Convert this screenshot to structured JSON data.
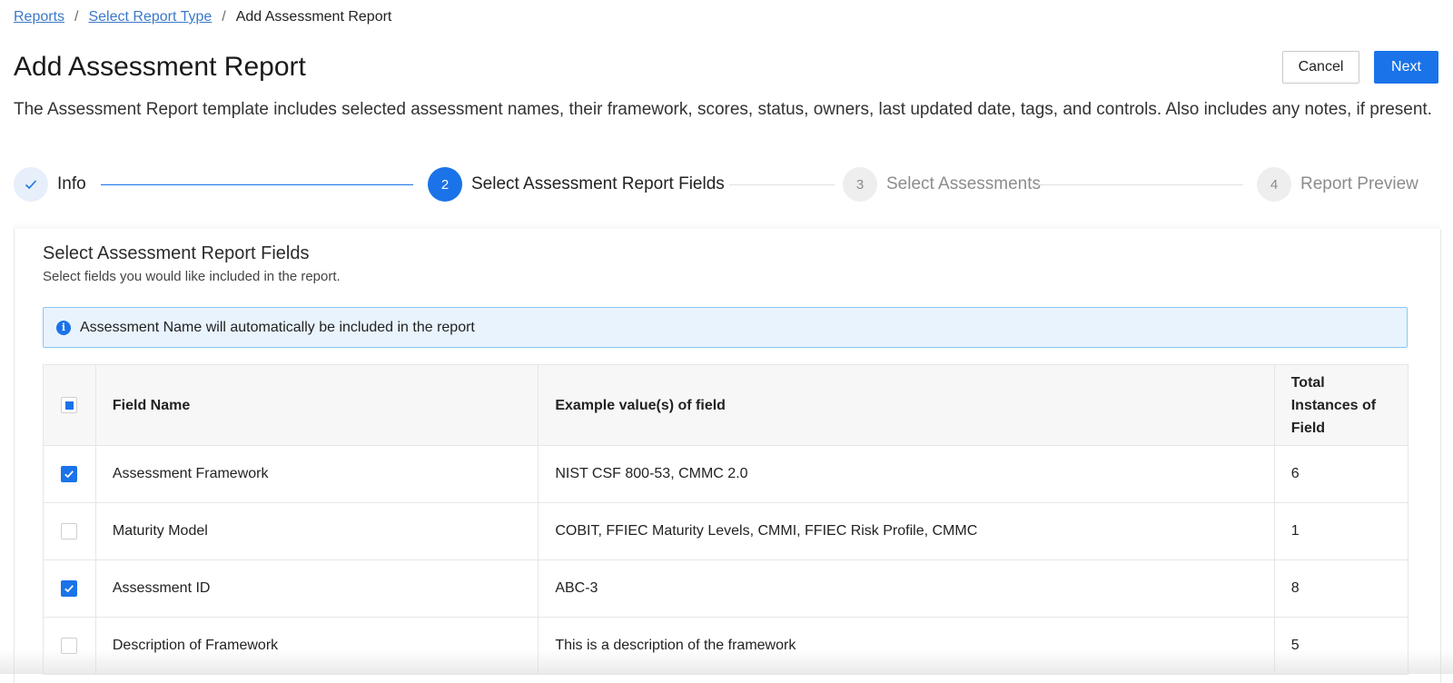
{
  "breadcrumb": {
    "items": [
      "Reports",
      "Select Report Type"
    ],
    "separator": "/",
    "current": "Add Assessment Report"
  },
  "page": {
    "title": "Add Assessment Report",
    "description": "The Assessment Report template includes selected assessment names, their framework, scores, status, owners, last updated date, tags, and controls. Also includes any notes, if present."
  },
  "actions": {
    "cancel_label": "Cancel",
    "next_label": "Next"
  },
  "stepper": {
    "steps": [
      {
        "number": "",
        "label": "Info",
        "state": "done",
        "icon": "check-icon"
      },
      {
        "number": "2",
        "label": "Select Assessment Report Fields",
        "state": "active"
      },
      {
        "number": "3",
        "label": "Select Assessments",
        "state": "pending"
      },
      {
        "number": "4",
        "label": "Report Preview",
        "state": "pending"
      }
    ]
  },
  "section": {
    "title": "Select Assessment Report Fields",
    "subtitle": "Select fields you would like included in the report."
  },
  "info_banner": {
    "icon": "info-icon",
    "text": "Assessment Name will automatically be included in the report"
  },
  "table": {
    "header_checkbox_state": "indeterminate",
    "columns": [
      "Field Name",
      "Example value(s) of field",
      "Total Instances of Field"
    ],
    "rows": [
      {
        "checked": true,
        "name": "Assessment Framework",
        "example": "NIST CSF 800-53, CMMC 2.0",
        "total": "6"
      },
      {
        "checked": false,
        "name": "Maturity Model",
        "example": "COBIT, FFIEC Maturity Levels, CMMI, FFIEC Risk Profile, CMMC",
        "total": "1"
      },
      {
        "checked": true,
        "name": "Assessment ID",
        "example": "ABC-3",
        "total": "8"
      },
      {
        "checked": false,
        "name": "Description of Framework",
        "example": "This is a description of the framework",
        "total": "5"
      }
    ]
  },
  "colors": {
    "primary": "#1a73e8",
    "link": "#3b78c9",
    "banner_bg": "#e8f3fd",
    "banner_border": "#8cc6ee"
  }
}
